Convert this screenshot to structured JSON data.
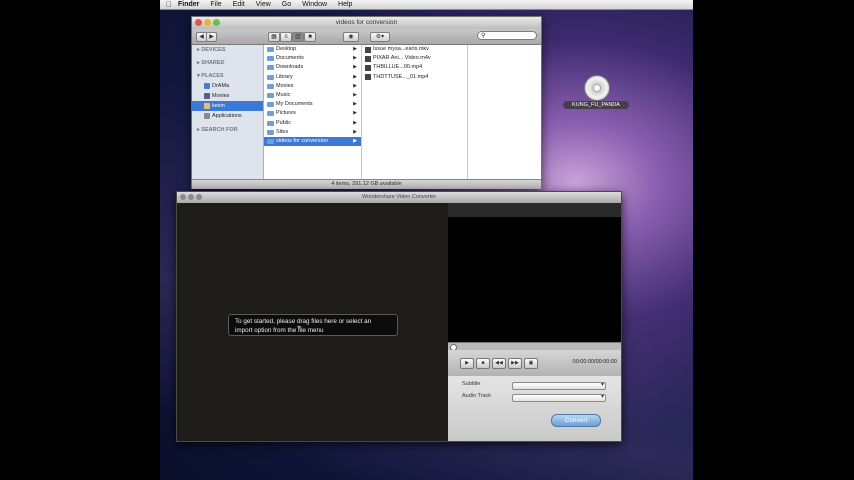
{
  "menubar": {
    "apple": "",
    "items": [
      "Finder",
      "File",
      "Edit",
      "View",
      "Go",
      "Window",
      "Help"
    ]
  },
  "finder": {
    "title": "videos for conversion",
    "search_placeholder": "",
    "sidebar": {
      "devices_header": "▸ DEVICES",
      "shared_header": "▸ SHARED",
      "places_header": "▾ PLACES",
      "items": [
        "DrAMa",
        "Movies",
        "kevin",
        "Applications"
      ],
      "search_header": "▸ SEARCH FOR"
    },
    "column1": [
      "Desktop",
      "Documents",
      "Downloads",
      "Library",
      "Movies",
      "Music",
      "My Documents",
      "Pictures",
      "Public",
      "Sites",
      "videos for conversion"
    ],
    "column2": [
      "Issue mysa...earls.mkv",
      "PIXAR Ani... Video.m4v",
      "THBILLUE...00.mp4",
      "THDTTUSE..._01.mp4"
    ],
    "status": "4 items, 291.12 GB available"
  },
  "desktop_disk": {
    "label": "KUNG_FU_PANDA"
  },
  "converter": {
    "title": "Wondershare Video Converter",
    "tip_line1": "To get started, please drag files here or select an",
    "tip_line2": "import option from the file menu",
    "time": "00:00:00/00:00:00",
    "subtitle_label": "Subtitle",
    "audio_label": "Audio Track",
    "convert_label": "Convert"
  }
}
